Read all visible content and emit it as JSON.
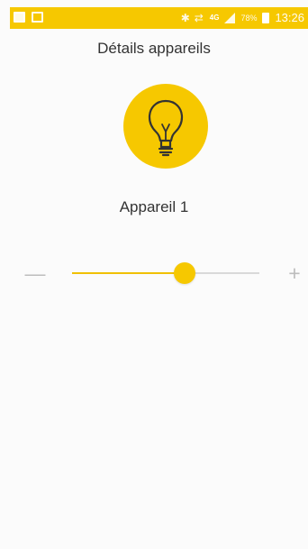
{
  "status_bar": {
    "network": "4G",
    "battery_percent": "78%",
    "time": "13:26",
    "icons": [
      "gallery-icon",
      "bluetooth-icon",
      "mute-icon",
      "signal-icon",
      "battery-icon"
    ]
  },
  "page": {
    "title": "Détails appareils"
  },
  "device": {
    "name": "Appareil 1",
    "icon": "light-bulb-icon",
    "brightness_fraction": 0.6
  },
  "controls": {
    "minus_label": "—",
    "plus_label": "+"
  },
  "colors": {
    "accent": "#f6c800",
    "track": "#d9d9d9",
    "text": "#333333",
    "control": "#bdbdbd"
  }
}
